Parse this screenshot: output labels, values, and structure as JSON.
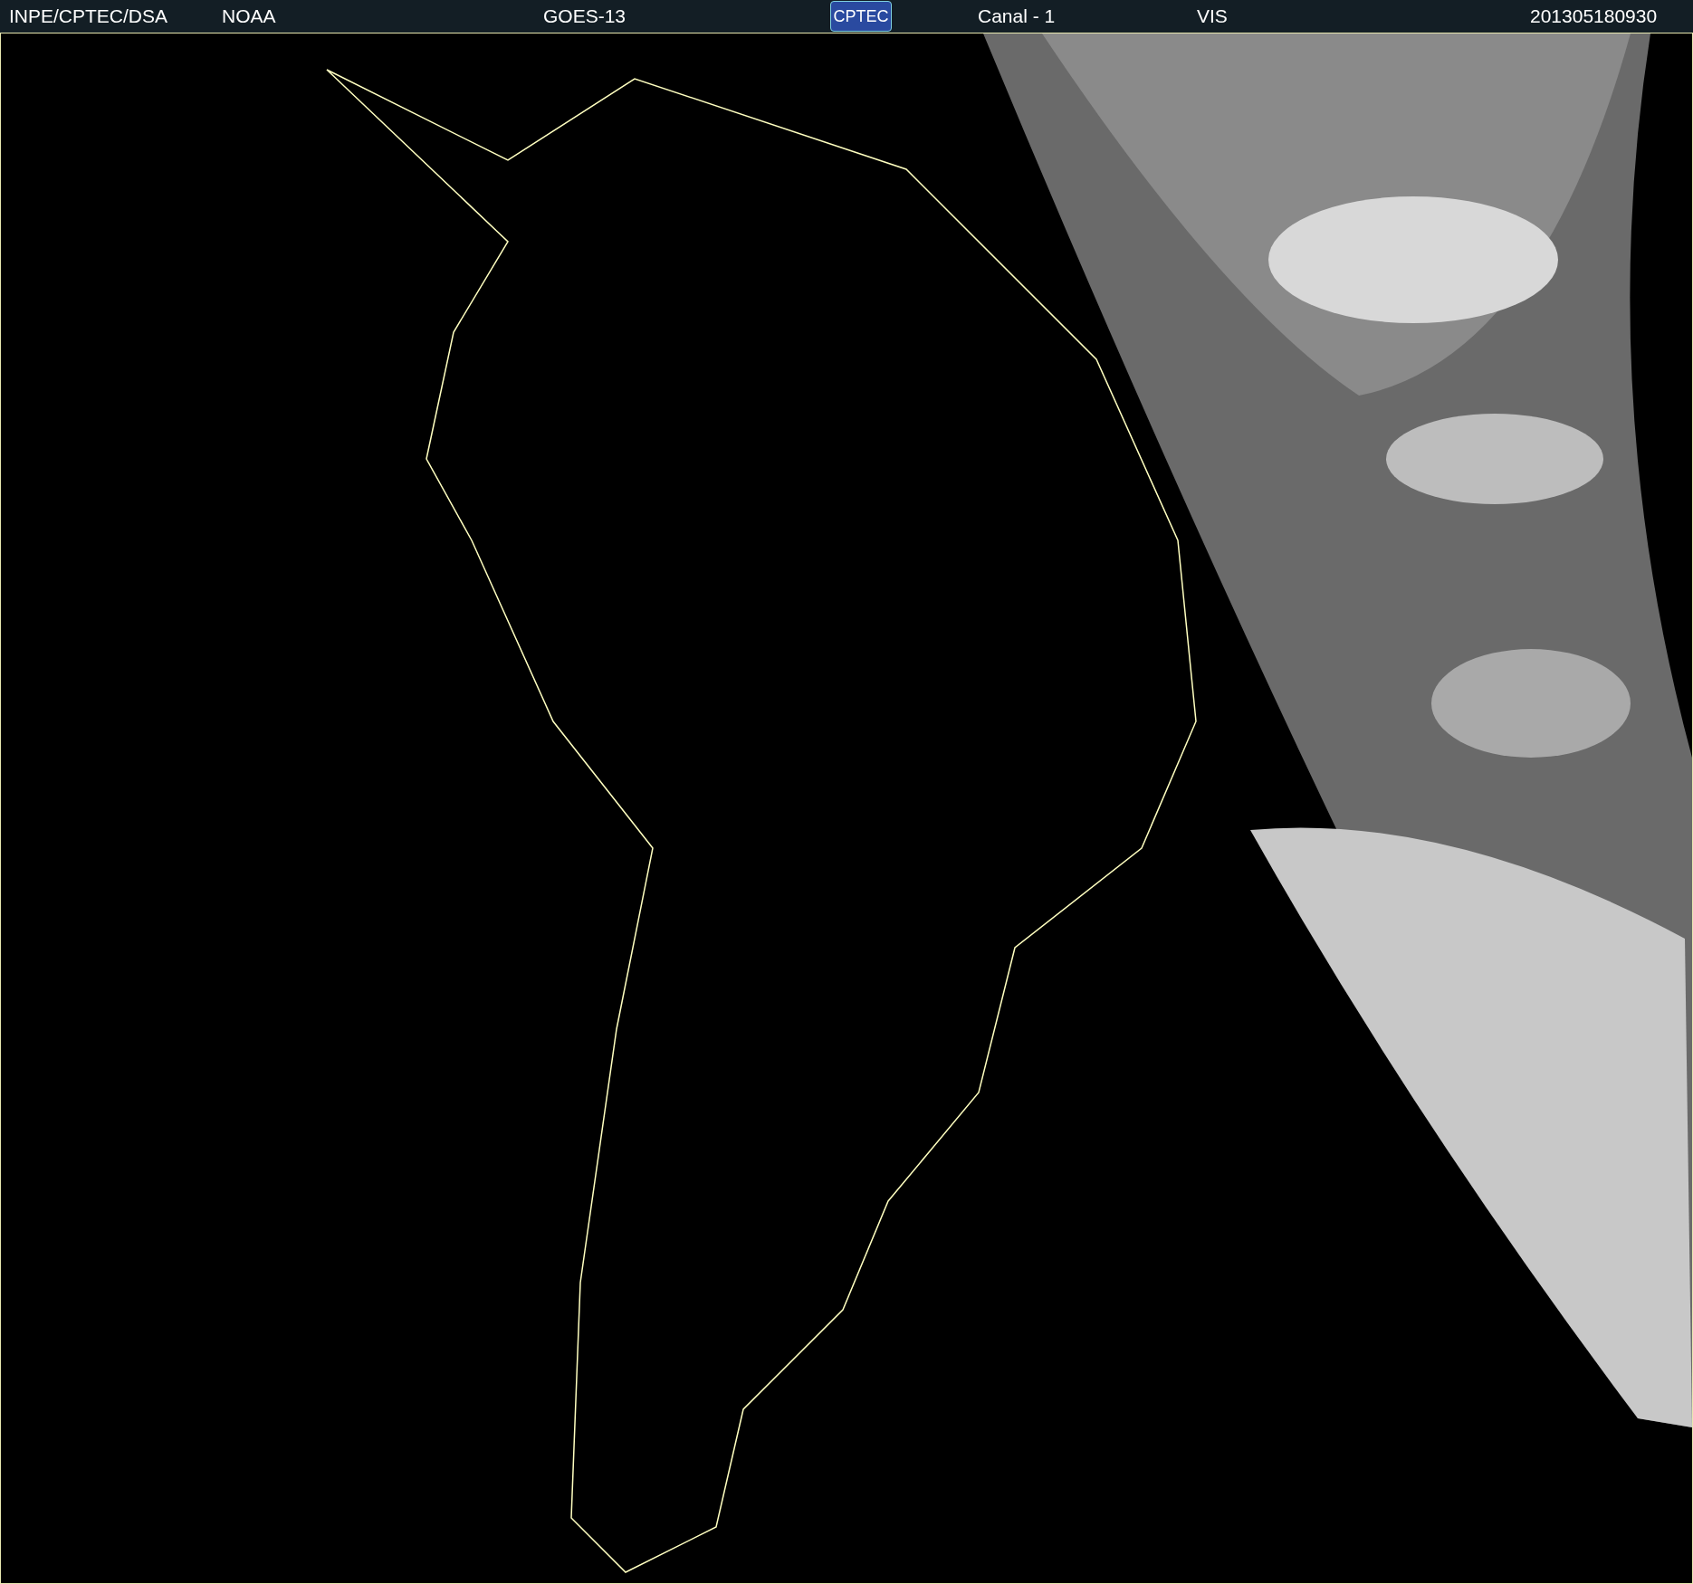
{
  "header": {
    "items": [
      {
        "kind": "text",
        "label": "INPE/CPTEC/DSA"
      },
      {
        "kind": "text",
        "label": "NOAA"
      },
      {
        "kind": "text",
        "label": "GOES-13"
      },
      {
        "kind": "logo",
        "label": "CPTEC"
      },
      {
        "kind": "text",
        "label": "Canal - 1"
      },
      {
        "kind": "text",
        "label": "VIS"
      },
      {
        "kind": "text",
        "label": "201305180930"
      }
    ]
  }
}
